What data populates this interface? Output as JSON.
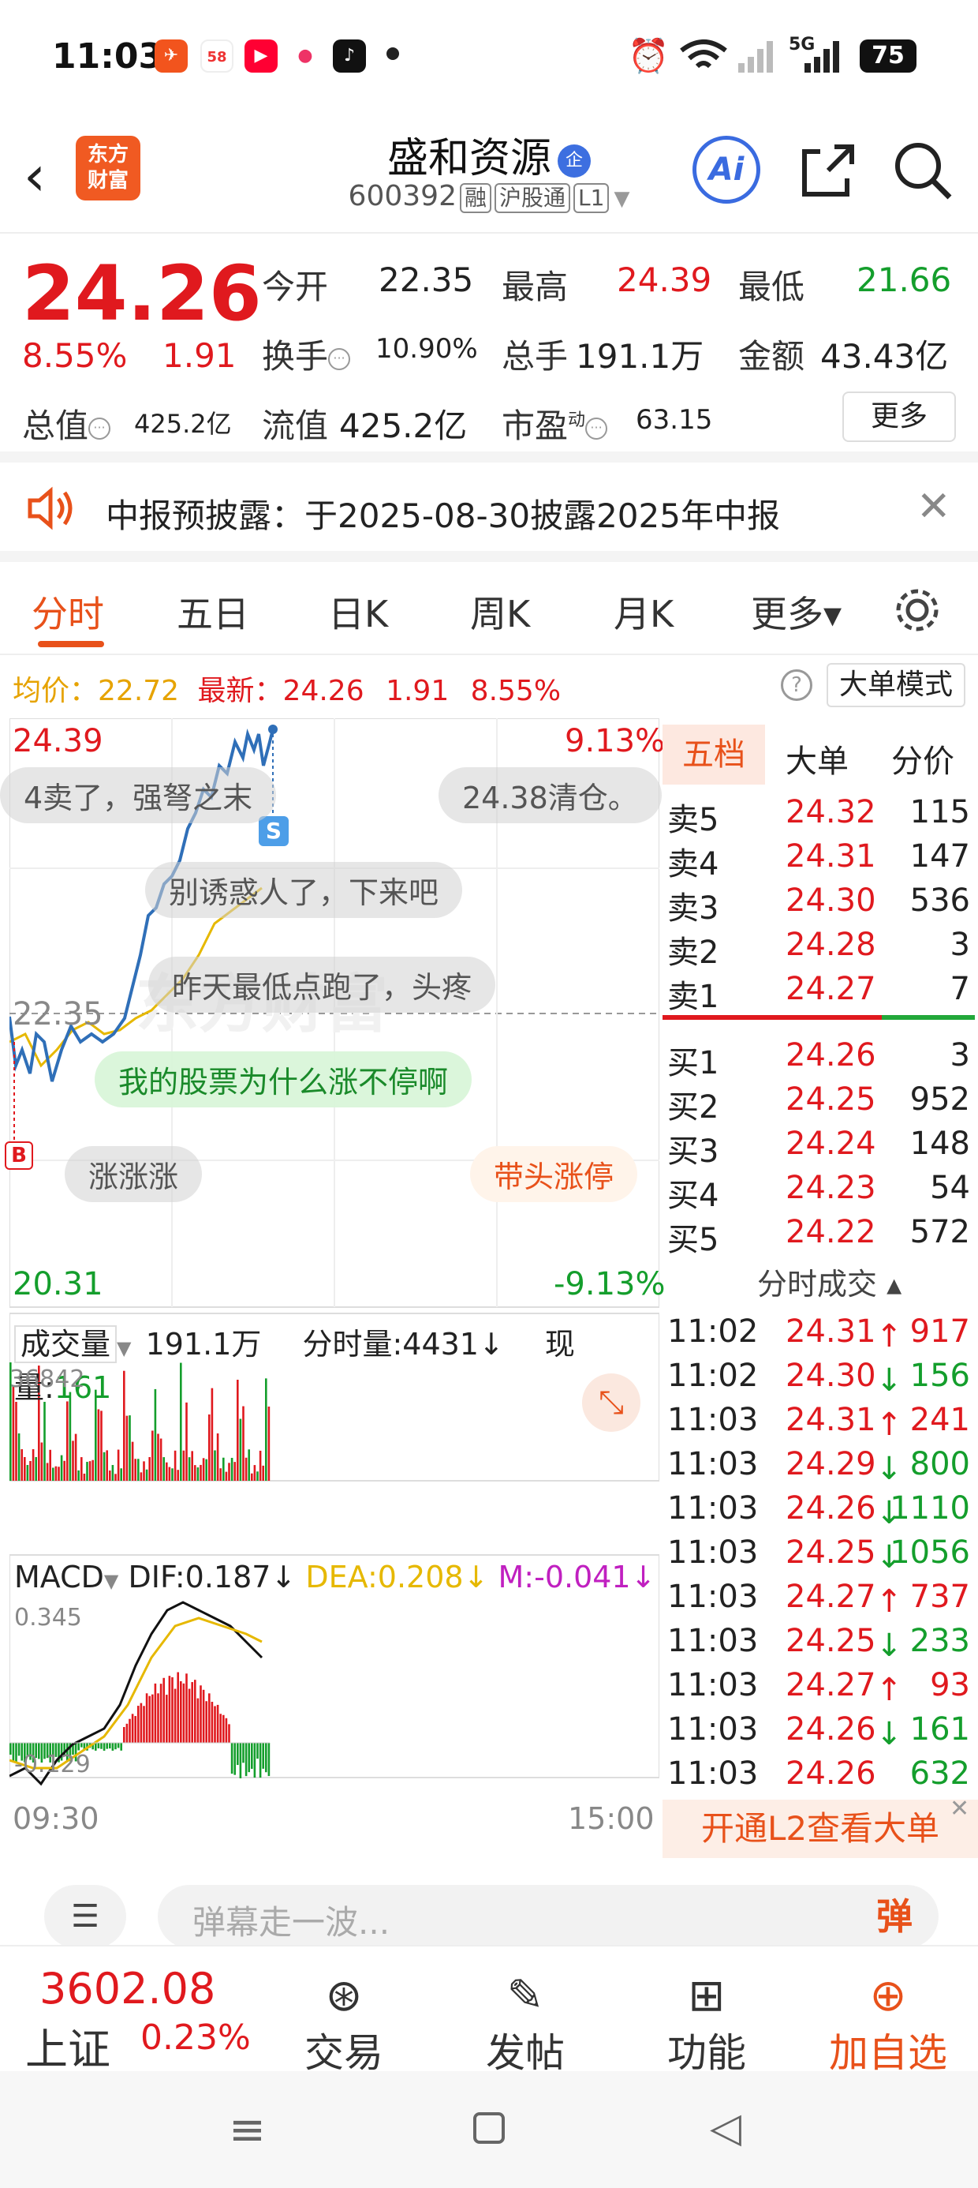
{
  "status": {
    "time": "11:03",
    "battery": "75",
    "net": "5G"
  },
  "header": {
    "stock_name": "盛和资源",
    "ent_badge": "企",
    "code": "600392",
    "tags": [
      "融",
      "沪股通",
      "L1"
    ],
    "logo_line1": "东方",
    "logo_line2": "财富",
    "ai_label": "Ai"
  },
  "quote": {
    "price": "24.26",
    "chg_pct": "8.55%",
    "chg_val": "1.91",
    "open_label": "今开",
    "open": "22.35",
    "high_label": "最高",
    "high": "24.39",
    "low_label": "最低",
    "low": "21.66",
    "turnover_label": "换手",
    "turnover": "10.90%",
    "volume_label": "总手",
    "volume": "191.1万",
    "amount_label": "金额",
    "amount": "43.43亿",
    "mktcap_label": "总值",
    "mktcap": "425.2亿",
    "float_label": "流值",
    "float": "425.2亿",
    "pe_label": "市盈",
    "pe_sup": "动",
    "pe": "63.15",
    "more": "更多"
  },
  "notice": {
    "text": "中报预披露：于2025-08-30披露2025年中报"
  },
  "tabs": [
    "分时",
    "五日",
    "日K",
    "周K",
    "月K",
    "更多▾"
  ],
  "avgline": {
    "avg_label": "均价：",
    "avg": "22.72",
    "latest_label": "最新：",
    "latest": "24.26",
    "chg": "1.91",
    "pct": "8.55%",
    "bigmode": "大单模式"
  },
  "chart": {
    "top_price": "24.39",
    "top_pct": "9.13%",
    "mid_price": "22.35",
    "bottom_price": "20.31",
    "bottom_pct": "-9.13%",
    "vol_label": "成交量",
    "vol_total": "191.1万",
    "fenshi_label": "分时量:4431↓",
    "xianliang_label": "现量:",
    "xianliang": "161",
    "vol_max": "36842",
    "macd_label": "MACD",
    "dif": "DIF:0.187↓",
    "dea": "DEA:0.208↓",
    "m": "M:-0.041↓",
    "macd_top": "0.345",
    "macd_bottom": "-0.129",
    "time_start": "09:30",
    "time_end": "15:00",
    "b_marker": "B",
    "s_marker": "S"
  },
  "danmu": [
    "4卖了，强弩之末",
    "24.38清仓。",
    "别诱惑人了，下来吧",
    "昨天最低点跑了，头疼",
    "我的股票为什么涨不停啊",
    "涨涨涨",
    "带头涨停"
  ],
  "orderbook": {
    "tabs": [
      "五档",
      "大单",
      "分价"
    ],
    "asks": [
      {
        "label": "卖5",
        "price": "24.32",
        "vol": "115"
      },
      {
        "label": "卖4",
        "price": "24.31",
        "vol": "147"
      },
      {
        "label": "卖3",
        "price": "24.30",
        "vol": "536"
      },
      {
        "label": "卖2",
        "price": "24.28",
        "vol": "3"
      },
      {
        "label": "卖1",
        "price": "24.27",
        "vol": "7"
      }
    ],
    "bids": [
      {
        "label": "买1",
        "price": "24.26",
        "vol": "3"
      },
      {
        "label": "买2",
        "price": "24.25",
        "vol": "952"
      },
      {
        "label": "买3",
        "price": "24.24",
        "vol": "148"
      },
      {
        "label": "买4",
        "price": "24.23",
        "vol": "54"
      },
      {
        "label": "买5",
        "price": "24.22",
        "vol": "572"
      }
    ],
    "ticks_title": "分时成交 ▴",
    "ticks": [
      {
        "t": "11:02",
        "p": "24.31↑",
        "v": "917",
        "c": "red"
      },
      {
        "t": "11:02",
        "p": "24.30↓",
        "v": "156",
        "c": "green"
      },
      {
        "t": "11:03",
        "p": "24.31↑",
        "v": "241",
        "c": "red"
      },
      {
        "t": "11:03",
        "p": "24.29↓",
        "v": "800",
        "c": "green"
      },
      {
        "t": "11:03",
        "p": "24.26↓",
        "v": "1110",
        "c": "green"
      },
      {
        "t": "11:03",
        "p": "24.25↓",
        "v": "1056",
        "c": "green"
      },
      {
        "t": "11:03",
        "p": "24.27↑",
        "v": "737",
        "c": "red"
      },
      {
        "t": "11:03",
        "p": "24.25↓",
        "v": "233",
        "c": "green"
      },
      {
        "t": "11:03",
        "p": "24.27↑",
        "v": "93",
        "c": "red"
      },
      {
        "t": "11:03",
        "p": "24.26↓",
        "v": "161",
        "c": "green"
      },
      {
        "t": "11:03",
        "p": "24.26",
        "v": "632",
        "c": "green"
      }
    ],
    "l2": "开通L2查看大单"
  },
  "danmu_input": {
    "placeholder": "弹幕走一波...",
    "btn": "弹"
  },
  "bottom": {
    "index_val": "3602.08",
    "index_name": "上证",
    "index_pct": "0.23%",
    "trade": "交易",
    "post": "发帖",
    "func": "功能",
    "add": "加自选"
  },
  "colors": {
    "red": "#e0191e",
    "green": "#149e2c",
    "accent": "#e8511a",
    "blue": "#3a6be0"
  }
}
